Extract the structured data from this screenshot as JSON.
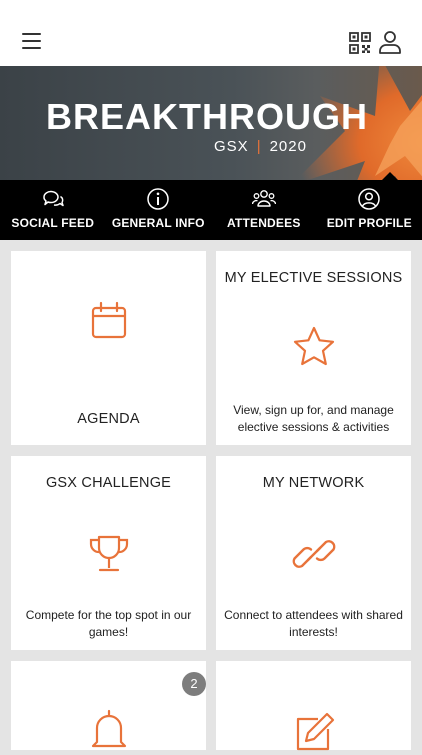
{
  "header": {
    "menu_icon": "hamburger-menu-icon",
    "qr_icon": "qr-code-icon",
    "profile_icon": "user-profile-icon"
  },
  "banner": {
    "title": "BREAKTHROUGH",
    "subtitle_left": "GSX",
    "subtitle_sep": "|",
    "subtitle_right": "2020",
    "accent_color": "#e8733a"
  },
  "nav": {
    "items": [
      {
        "label": "SOCIAL FEED",
        "icon": "chat-bubbles-icon"
      },
      {
        "label": "GENERAL INFO",
        "icon": "info-circle-icon"
      },
      {
        "label": "ATTENDEES",
        "icon": "people-group-icon"
      },
      {
        "label": "EDIT PROFILE",
        "icon": "user-circle-icon"
      }
    ]
  },
  "tiles": {
    "agenda": {
      "title": "AGENDA",
      "icon": "calendar-icon"
    },
    "elective": {
      "title": "MY ELECTIVE SESSIONS",
      "description": "View, sign up for, and manage elective sessions & activities",
      "icon": "star-icon"
    },
    "challenge": {
      "title": "GSX CHALLENGE",
      "description": "Compete for the top spot in our games!",
      "icon": "trophy-icon"
    },
    "network": {
      "title": "MY NETWORK",
      "description": "Connect to attendees with shared interests!",
      "icon": "link-icon"
    },
    "notifications": {
      "badge": "2",
      "icon": "bell-icon"
    },
    "notes": {
      "icon": "edit-note-icon"
    }
  },
  "colors": {
    "accent": "#e8733a",
    "nav_background": "#000000",
    "page_background": "#e4e4e4"
  }
}
